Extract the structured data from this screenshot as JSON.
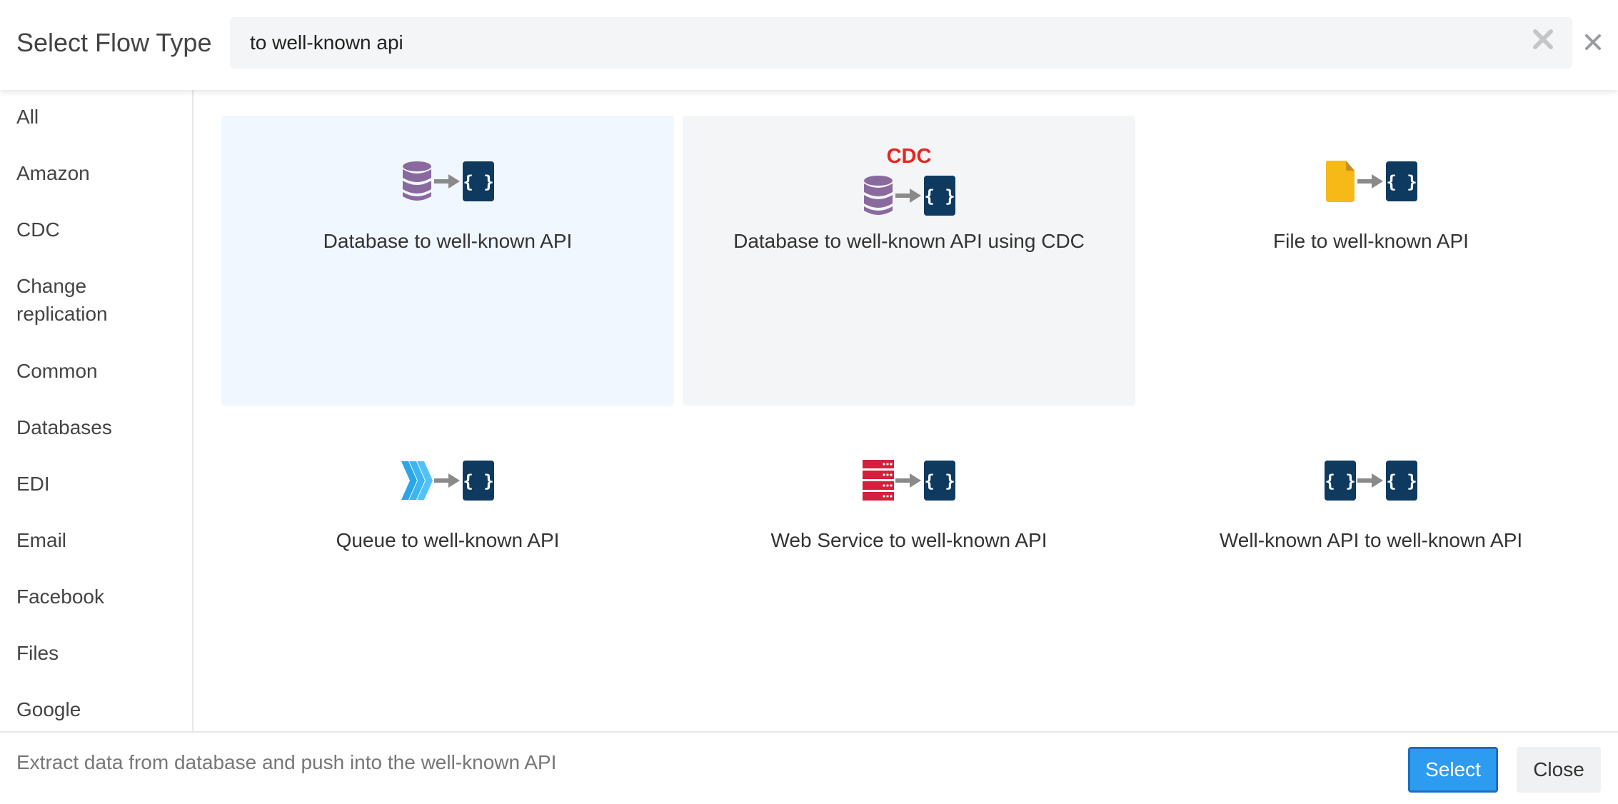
{
  "header": {
    "title": "Select Flow Type",
    "search": {
      "value": "to well-known api",
      "placeholder": ""
    }
  },
  "sidebar": {
    "categories": [
      "All",
      "Amazon",
      "CDC",
      "Change replication",
      "Common",
      "Databases",
      "EDI",
      "Email",
      "Facebook",
      "Files",
      "Google"
    ]
  },
  "flows": [
    {
      "label": "Database to well-known API",
      "source_icon": "database-icon",
      "target_icon": "api-braces-icon",
      "state": "selected"
    },
    {
      "label": "Database to well-known API using CDC",
      "badge": "CDC",
      "source_icon": "database-icon",
      "target_icon": "api-braces-icon",
      "state": "hover"
    },
    {
      "label": "File to well-known API",
      "source_icon": "file-icon",
      "target_icon": "api-braces-icon",
      "state": "normal"
    },
    {
      "label": "Queue to well-known API",
      "source_icon": "queue-chevrons-icon",
      "target_icon": "api-braces-icon",
      "state": "normal"
    },
    {
      "label": "Web Service to well-known API",
      "source_icon": "server-icon",
      "target_icon": "api-braces-icon",
      "state": "normal"
    },
    {
      "label": "Well-known API to well-known API",
      "source_icon": "api-braces-icon",
      "target_icon": "api-braces-icon",
      "state": "normal"
    }
  ],
  "footer": {
    "description": "Extract data from database and push into the well-known API",
    "select_label": "Select",
    "close_label": "Close"
  },
  "colors": {
    "accent": "#2d9cf0",
    "selected_card_bg": "#f0f7fe",
    "hover_card_bg": "#f4f5f6",
    "api_icon": "#0f3a5f",
    "database_icon": "#8a6a9e",
    "file_icon": "#f6b918",
    "queue_icon": "#2aa6e8",
    "server_icon": "#d3203c",
    "cdc_badge": "#e52521",
    "arrow": "#8a8a8a"
  }
}
